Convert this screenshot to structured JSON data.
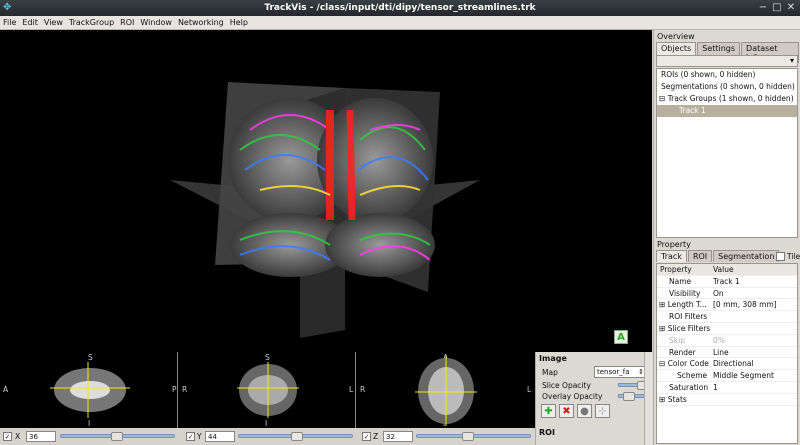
{
  "window": {
    "title": "TrackVis - /class/input/dti/dipy/tensor_streamlines.trk"
  },
  "menu": [
    "File",
    "Edit",
    "View",
    "TrackGroup",
    "ROI",
    "Window",
    "Networking",
    "Help"
  ],
  "overview": {
    "heading": "Overview",
    "tabs": [
      "Objects",
      "Settings",
      "Dataset Info"
    ],
    "tree": [
      {
        "label": "ROIs (0 shown, 0 hidden)",
        "toggle": ""
      },
      {
        "label": "Segmentations (0 shown, 0 hidden)",
        "toggle": ""
      },
      {
        "label": "Track Groups (1 shown, 0 hidden)",
        "toggle": "⊟"
      },
      {
        "label": "Track 1",
        "toggle": ""
      }
    ]
  },
  "property": {
    "heading": "Property",
    "tabs": [
      "Track",
      "ROI",
      "Segmentation"
    ],
    "tile_label": "Tile",
    "header": {
      "col1": "Property",
      "col2": "Value"
    },
    "rows": [
      {
        "name": "Name",
        "value": "Track 1",
        "toggle": ""
      },
      {
        "name": "Visibility",
        "value": "On",
        "toggle": ""
      },
      {
        "name": "Length T...",
        "value": "[0 mm,  308 mm]",
        "toggle": "⊞"
      },
      {
        "name": "ROI Filters",
        "value": "",
        "toggle": ""
      },
      {
        "name": "Slice Filters",
        "value": "",
        "toggle": "⊞"
      },
      {
        "name": "Skip",
        "value": "0%",
        "toggle": ""
      },
      {
        "name": "Render",
        "value": "Line",
        "toggle": ""
      },
      {
        "name": "Color Code",
        "value": "Directional",
        "toggle": "⊟"
      },
      {
        "name": "Scheme",
        "value": "Middle Segment",
        "toggle": ""
      },
      {
        "name": "Saturation",
        "value": "1",
        "toggle": ""
      },
      {
        "name": "Stats",
        "value": "",
        "toggle": "⊞"
      }
    ]
  },
  "slices": {
    "x": {
      "label": "X",
      "value": "36",
      "top": "S",
      "left": "A",
      "right": "P",
      "bottom": "I"
    },
    "y": {
      "label": "Y",
      "value": "44",
      "top": "S",
      "left": "R",
      "right": "L",
      "bottom": "I"
    },
    "z": {
      "label": "Z",
      "value": "32",
      "top": "A",
      "left": "R",
      "right": "L",
      "bottom": "P"
    }
  },
  "image_panel": {
    "heading": "Image",
    "map_label": "Map",
    "map_value": "tensor_fa",
    "slice_opacity": "Slice Opacity",
    "overlay_opacity": "Overlay Opacity",
    "roi_heading": "ROI"
  },
  "orientation_badge": "A",
  "colors": {
    "accent": "#b7b09f",
    "bg": "#d6d2cc",
    "view_bg": "#000000"
  }
}
